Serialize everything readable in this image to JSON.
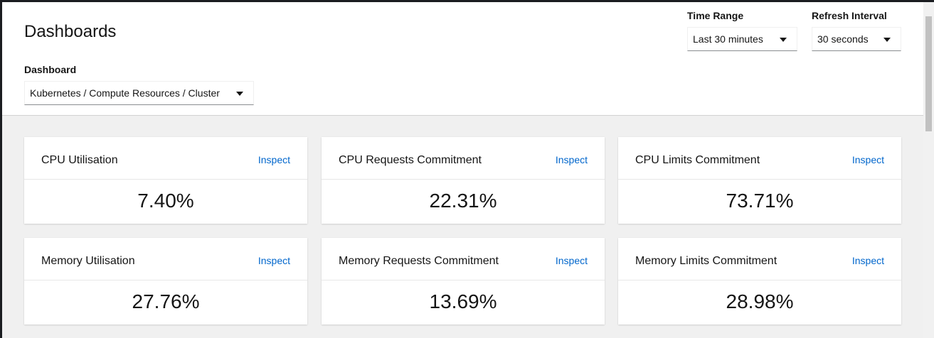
{
  "header": {
    "title": "Dashboards",
    "time_range": {
      "label": "Time Range",
      "value": "Last 30 minutes"
    },
    "refresh_interval": {
      "label": "Refresh Interval",
      "value": "30 seconds"
    },
    "dashboard": {
      "label": "Dashboard",
      "value": "Kubernetes / Compute Resources / Cluster"
    }
  },
  "cards": [
    {
      "title": "CPU Utilisation",
      "link": "Inspect",
      "value": "7.40%"
    },
    {
      "title": "CPU Requests Commitment",
      "link": "Inspect",
      "value": "22.31%"
    },
    {
      "title": "CPU Limits Commitment",
      "link": "Inspect",
      "value": "73.71%"
    },
    {
      "title": "Memory Utilisation",
      "link": "Inspect",
      "value": "27.76%"
    },
    {
      "title": "Memory Requests Commitment",
      "link": "Inspect",
      "value": "13.69%"
    },
    {
      "title": "Memory Limits Commitment",
      "link": "Inspect",
      "value": "28.98%"
    }
  ],
  "colors": {
    "link": "#0066cc",
    "background": "#f0f0f0",
    "card": "#ffffff"
  }
}
